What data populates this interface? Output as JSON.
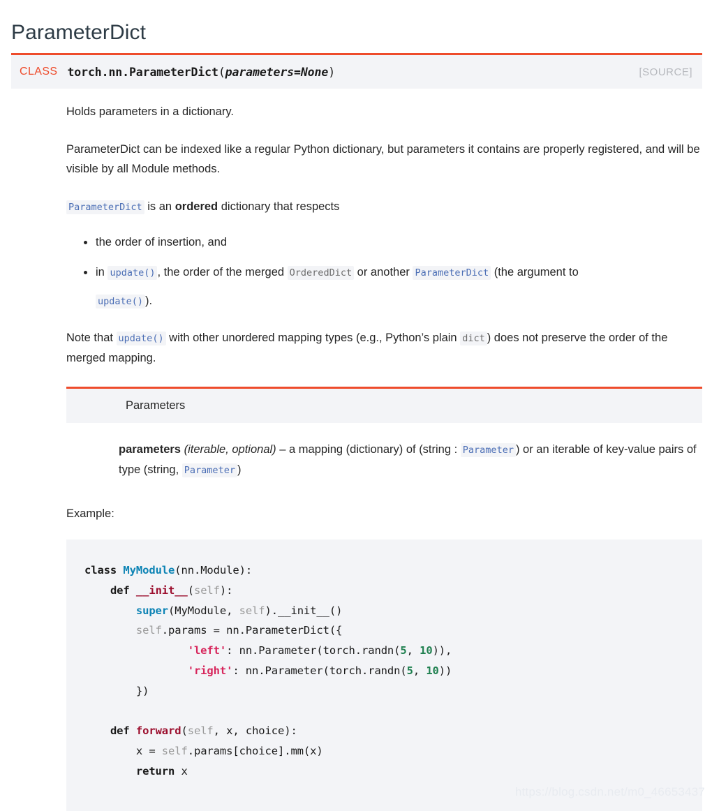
{
  "page": {
    "title": "ParameterDict",
    "watermark": "https://blog.csdn.net/m0_46653437"
  },
  "signature": {
    "kind_label": "CLASS",
    "qualified_name": "torch.nn.ParameterDict",
    "open_paren": "(",
    "argument": "parameters=None",
    "close_paren": ")",
    "source_link": "[SOURCE]",
    "accent_color": "#ee4c2c",
    "background_color": "#f3f4f7"
  },
  "description": {
    "summary": "Holds parameters in a dictionary.",
    "paragraph_2": "ParameterDict can be indexed like a regular Python dictionary, but parameters it contains are properly registered, and will be visible by all Module methods.",
    "ordered_intro": {
      "code": "ParameterDict",
      "text_before_bold": " is an ",
      "bold": "ordered",
      "text_after_bold": " dictionary that respects"
    },
    "bullets": [
      {
        "text": "the order of insertion, and"
      },
      {
        "segments": [
          {
            "type": "text",
            "value": "in "
          },
          {
            "type": "code-link",
            "value": "update()"
          },
          {
            "type": "text",
            "value": ", the order of the merged "
          },
          {
            "type": "code-plain",
            "value": "OrderedDict"
          },
          {
            "type": "text",
            "value": " or another "
          },
          {
            "type": "code-link",
            "value": "ParameterDict"
          },
          {
            "type": "text",
            "value": " (the argument to"
          },
          {
            "type": "break",
            "value": ""
          },
          {
            "type": "code-link",
            "value": "update()"
          },
          {
            "type": "text",
            "value": ")."
          }
        ]
      }
    ],
    "note": {
      "before": "Note that ",
      "code1": "update()",
      "middle": " with other unordered mapping types (e.g., Python’s plain ",
      "code2": "dict",
      "after": ") does not preserve the order of the merged mapping."
    }
  },
  "parameters_section": {
    "heading": "Parameters",
    "entry": {
      "name": "parameters",
      "type_note": "(iterable, optional)",
      "dash": " – ",
      "desc_part1": "a mapping (dictionary) of (string : ",
      "code1": "Parameter",
      "desc_part2": ") or an iterable of key-value pairs of type (string, ",
      "code2": "Parameter",
      "desc_part3": ")"
    }
  },
  "example": {
    "label": "Example:",
    "language": "python",
    "lines": [
      [
        {
          "t": "k",
          "v": "class "
        },
        {
          "t": "cn",
          "v": "MyModule"
        },
        {
          "t": "pl",
          "v": "(nn.Module):"
        }
      ],
      [
        {
          "t": "pl",
          "v": "    "
        },
        {
          "t": "k",
          "v": "def "
        },
        {
          "t": "fn",
          "v": "__init__"
        },
        {
          "t": "pl",
          "v": "("
        },
        {
          "t": "sf",
          "v": "self"
        },
        {
          "t": "pl",
          "v": "):"
        }
      ],
      [
        {
          "t": "pl",
          "v": "        "
        },
        {
          "t": "cn",
          "v": "super"
        },
        {
          "t": "pl",
          "v": "(MyModule, "
        },
        {
          "t": "sf",
          "v": "self"
        },
        {
          "t": "pl",
          "v": ").__init__()"
        }
      ],
      [
        {
          "t": "pl",
          "v": "        "
        },
        {
          "t": "sf",
          "v": "self"
        },
        {
          "t": "pl",
          "v": ".params = nn.ParameterDict({"
        }
      ],
      [
        {
          "t": "pl",
          "v": "                "
        },
        {
          "t": "st",
          "v": "'left'"
        },
        {
          "t": "pl",
          "v": ": nn.Parameter(torch.randn("
        },
        {
          "t": "nu",
          "v": "5"
        },
        {
          "t": "pl",
          "v": ", "
        },
        {
          "t": "nu",
          "v": "10"
        },
        {
          "t": "pl",
          "v": ")),"
        }
      ],
      [
        {
          "t": "pl",
          "v": "                "
        },
        {
          "t": "st",
          "v": "'right'"
        },
        {
          "t": "pl",
          "v": ": nn.Parameter(torch.randn("
        },
        {
          "t": "nu",
          "v": "5"
        },
        {
          "t": "pl",
          "v": ", "
        },
        {
          "t": "nu",
          "v": "10"
        },
        {
          "t": "pl",
          "v": "))"
        }
      ],
      [
        {
          "t": "pl",
          "v": "        })"
        }
      ],
      [
        {
          "t": "pl",
          "v": ""
        }
      ],
      [
        {
          "t": "pl",
          "v": "    "
        },
        {
          "t": "k",
          "v": "def "
        },
        {
          "t": "fn",
          "v": "forward"
        },
        {
          "t": "pl",
          "v": "("
        },
        {
          "t": "sf",
          "v": "self"
        },
        {
          "t": "pl",
          "v": ", x, choice):"
        }
      ],
      [
        {
          "t": "pl",
          "v": "        x = "
        },
        {
          "t": "sf",
          "v": "self"
        },
        {
          "t": "pl",
          "v": ".params[choice].mm(x)"
        }
      ],
      [
        {
          "t": "pl",
          "v": "        "
        },
        {
          "t": "k",
          "v": "return"
        },
        {
          "t": "pl",
          "v": " x"
        }
      ]
    ]
  }
}
